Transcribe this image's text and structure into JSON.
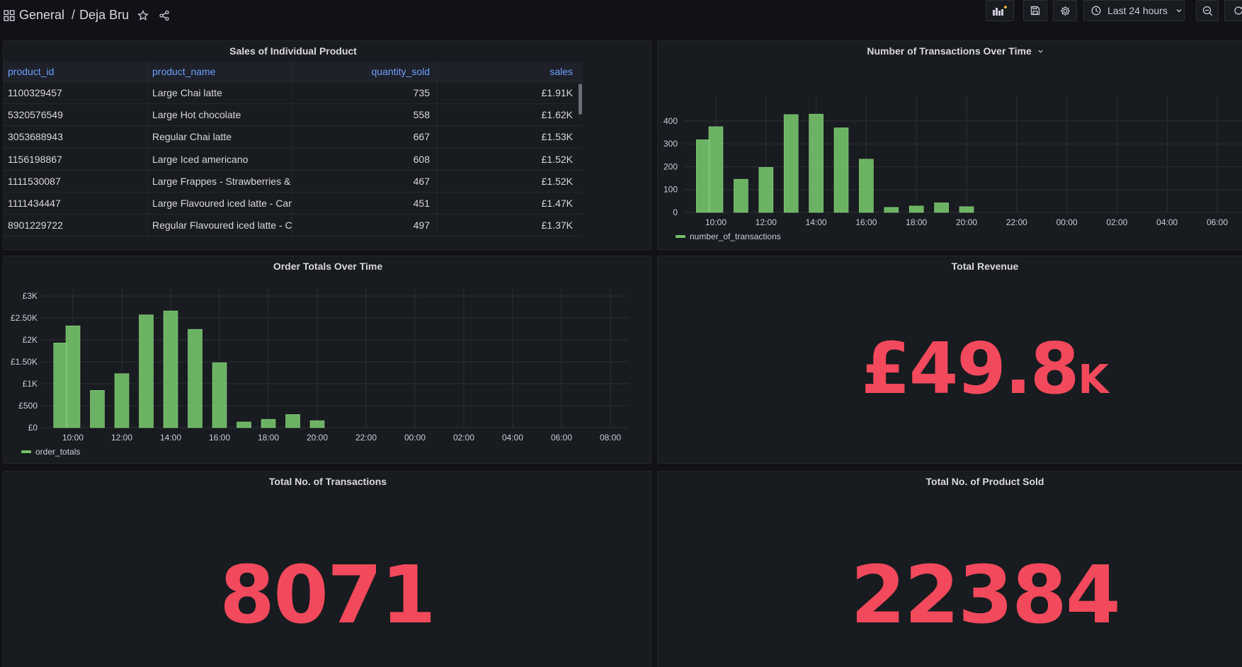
{
  "nav": {
    "folder": "General",
    "separator": "/",
    "dashboard": "Deja Bru",
    "time_range": "Last 24 hours"
  },
  "panels": {
    "table": {
      "title": "Sales of Individual Product",
      "columns": [
        "product_id",
        "product_name",
        "quantity_sold",
        "sales"
      ],
      "rows": [
        [
          "1100329457",
          "Large Chai latte",
          "735",
          "£1.91K"
        ],
        [
          "5320576549",
          "Large Hot chocolate",
          "558",
          "£1.62K"
        ],
        [
          "3053688943",
          "Regular Chai latte",
          "667",
          "£1.53K"
        ],
        [
          "1156198867",
          "Large Iced americano",
          "608",
          "£1.52K"
        ],
        [
          "1111530087",
          "Large Frappes - Strawberries & ...",
          "467",
          "£1.52K"
        ],
        [
          "1111434447",
          "Large Flavoured iced latte - Cara...",
          "451",
          "£1.47K"
        ],
        [
          "8901229722",
          "Regular Flavoured iced latte - Ca...",
          "497",
          "£1.37K"
        ]
      ]
    },
    "transactions_chart": {
      "title": "Number of Transactions Over Time",
      "legend": "number_of_transactions"
    },
    "orders_chart": {
      "title": "Order Totals Over Time",
      "legend": "order_totals"
    },
    "revenue": {
      "title": "Total Revenue",
      "value": "£49.8",
      "unit": "K"
    },
    "transactions_total": {
      "title": "Total No. of Transactions",
      "value": "8071"
    },
    "products_total": {
      "title": "Total No. of Product Sold",
      "value": "22384"
    }
  },
  "colors": {
    "bar": "#73bf69",
    "stat": "#f2495c",
    "link": "#6e9fff",
    "grid": "#2c2f36"
  },
  "chart_data": [
    {
      "type": "bar",
      "title": "Number of Transactions Over Time",
      "x": [
        "09:30",
        "10:00",
        "11:00",
        "12:00",
        "13:00",
        "14:00",
        "15:00",
        "16:00",
        "17:00",
        "18:00",
        "19:00",
        "20:00"
      ],
      "xticks": [
        "10:00",
        "12:00",
        "14:00",
        "16:00",
        "18:00",
        "20:00",
        "22:00",
        "00:00",
        "02:00",
        "04:00",
        "06:00"
      ],
      "series": [
        {
          "name": "number_of_transactions",
          "values": [
            318,
            375,
            145,
            197,
            428,
            430,
            370,
            233,
            22,
            28,
            42,
            25
          ]
        }
      ],
      "yticks": [
        "0",
        "100",
        "200",
        "300",
        "400"
      ],
      "ylim": [
        0,
        480
      ]
    },
    {
      "type": "bar",
      "title": "Order Totals Over Time",
      "x": [
        "09:30",
        "10:00",
        "11:00",
        "12:00",
        "13:00",
        "14:00",
        "15:00",
        "16:00",
        "17:00",
        "18:00",
        "19:00",
        "20:00"
      ],
      "xticks": [
        "10:00",
        "12:00",
        "14:00",
        "16:00",
        "18:00",
        "20:00",
        "22:00",
        "00:00",
        "02:00",
        "04:00",
        "06:00",
        "08:00"
      ],
      "series": [
        {
          "name": "order_totals",
          "values": [
            1930,
            2320,
            850,
            1230,
            2570,
            2660,
            2240,
            1480,
            130,
            190,
            300,
            160
          ]
        }
      ],
      "yticks": [
        "£0",
        "£500",
        "£1K",
        "£1.50K",
        "£2K",
        "£2.50K",
        "£3K"
      ],
      "ylim": [
        0,
        3000
      ]
    }
  ]
}
